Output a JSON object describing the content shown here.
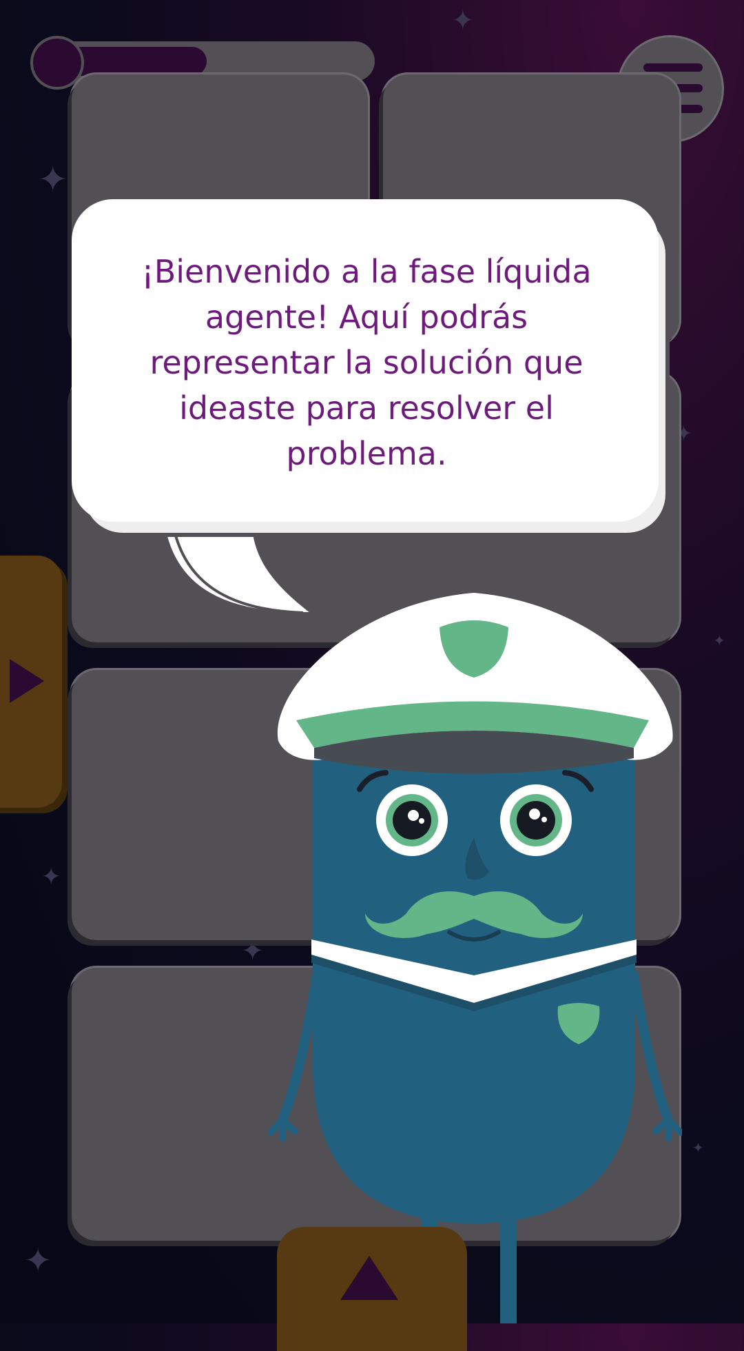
{
  "speech_bubble": {
    "text": "¡Bienvenido a la fase líquida agente! Aquí podrás representar la solución que ideaste para resolver el problema."
  },
  "progress_bar": {
    "progress": 0.45
  },
  "colors": {
    "background": "#0a0a1c",
    "panel": "#524f55",
    "accent_purple": "#2a0a30",
    "tab_brown": "#573a12",
    "text_purple": "#6e1a7c",
    "character_body": "#22607f",
    "character_green": "#62b688"
  },
  "icons": [
    "menu-icon",
    "play-right-icon",
    "arrow-up-icon"
  ]
}
